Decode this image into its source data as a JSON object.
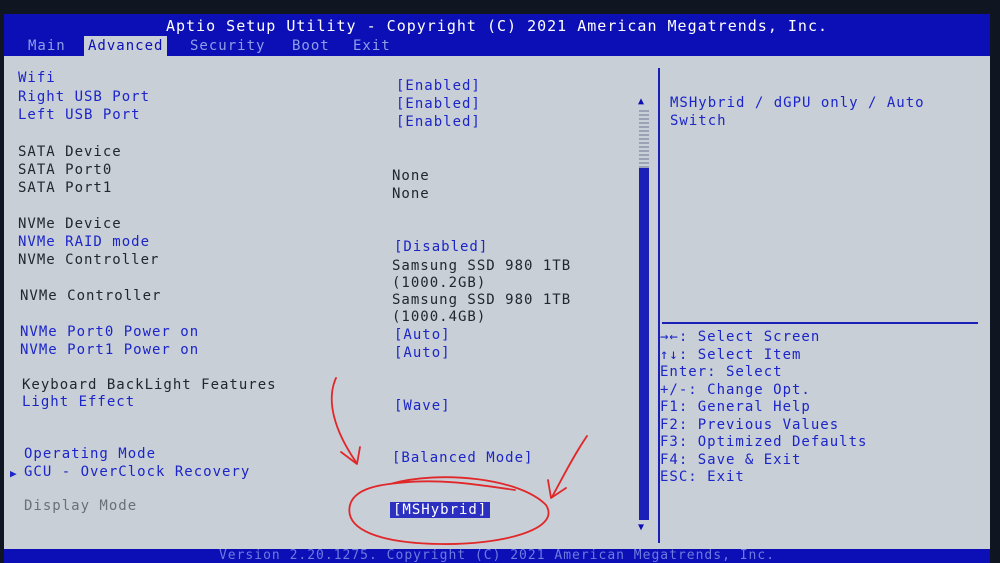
{
  "titlebar": {
    "title": "Aptio Setup Utility - Copyright (C) 2021 American Megatrends, Inc."
  },
  "tabs": [
    {
      "label": "Main",
      "active": false
    },
    {
      "label": "Advanced",
      "active": true
    },
    {
      "label": "Security",
      "active": false
    },
    {
      "label": "Boot",
      "active": false
    },
    {
      "label": "Exit",
      "active": false
    }
  ],
  "settings": {
    "wifi": {
      "label": "Wifi",
      "value": "[Enabled]"
    },
    "right_usb": {
      "label": "Right USB Port",
      "value": "[Enabled]"
    },
    "left_usb": {
      "label": "Left USB Port",
      "value": "[Enabled]"
    },
    "sata_device": {
      "label": "SATA Device"
    },
    "sata_port0": {
      "label": "SATA Port0",
      "value": "None"
    },
    "sata_port1": {
      "label": "SATA Port1",
      "value": "None"
    },
    "nvme_device": {
      "label": "NVMe Device"
    },
    "nvme_raid": {
      "label": "NVMe RAID mode",
      "value": "[Disabled]"
    },
    "nvme_ctrl1": {
      "label": "NVMe Controller",
      "value_line1": "Samsung SSD 980 1TB",
      "value_line2": "(1000.2GB)"
    },
    "nvme_ctrl2": {
      "label": "NVMe Controller",
      "value_line1": "Samsung SSD 980 1TB",
      "value_line2": "(1000.4GB)"
    },
    "nvme_port0_power": {
      "label": "NVMe Port0 Power on",
      "value": "[Auto]"
    },
    "nvme_port1_power": {
      "label": "NVMe Port1 Power on",
      "value": "[Auto]"
    },
    "keyboard_backlight": {
      "label": "Keyboard BackLight Features"
    },
    "light_effect": {
      "label": "Light Effect",
      "value": "[Wave]"
    },
    "operating_mode": {
      "label": "Operating Mode",
      "value": "[Balanced Mode]"
    },
    "gcu_recovery": {
      "label": "GCU - OverClock Recovery"
    },
    "display_mode": {
      "label": "Display Mode",
      "value": "[MSHybrid]"
    }
  },
  "help": {
    "description": "MSHybrid / dGPU only / Auto Switch"
  },
  "keys": [
    "→←: Select Screen",
    "↑↓: Select Item",
    "Enter: Select",
    "+/-: Change Opt.",
    "F1: General Help",
    "F2: Previous Values",
    "F3: Optimized Defaults",
    "F4: Save & Exit",
    "ESC: Exit"
  ],
  "footer": {
    "text": "Version 2.20.1275. Copyright (C) 2021 American Megatrends, Inc."
  },
  "annotation": {
    "color": "#e0282a"
  }
}
